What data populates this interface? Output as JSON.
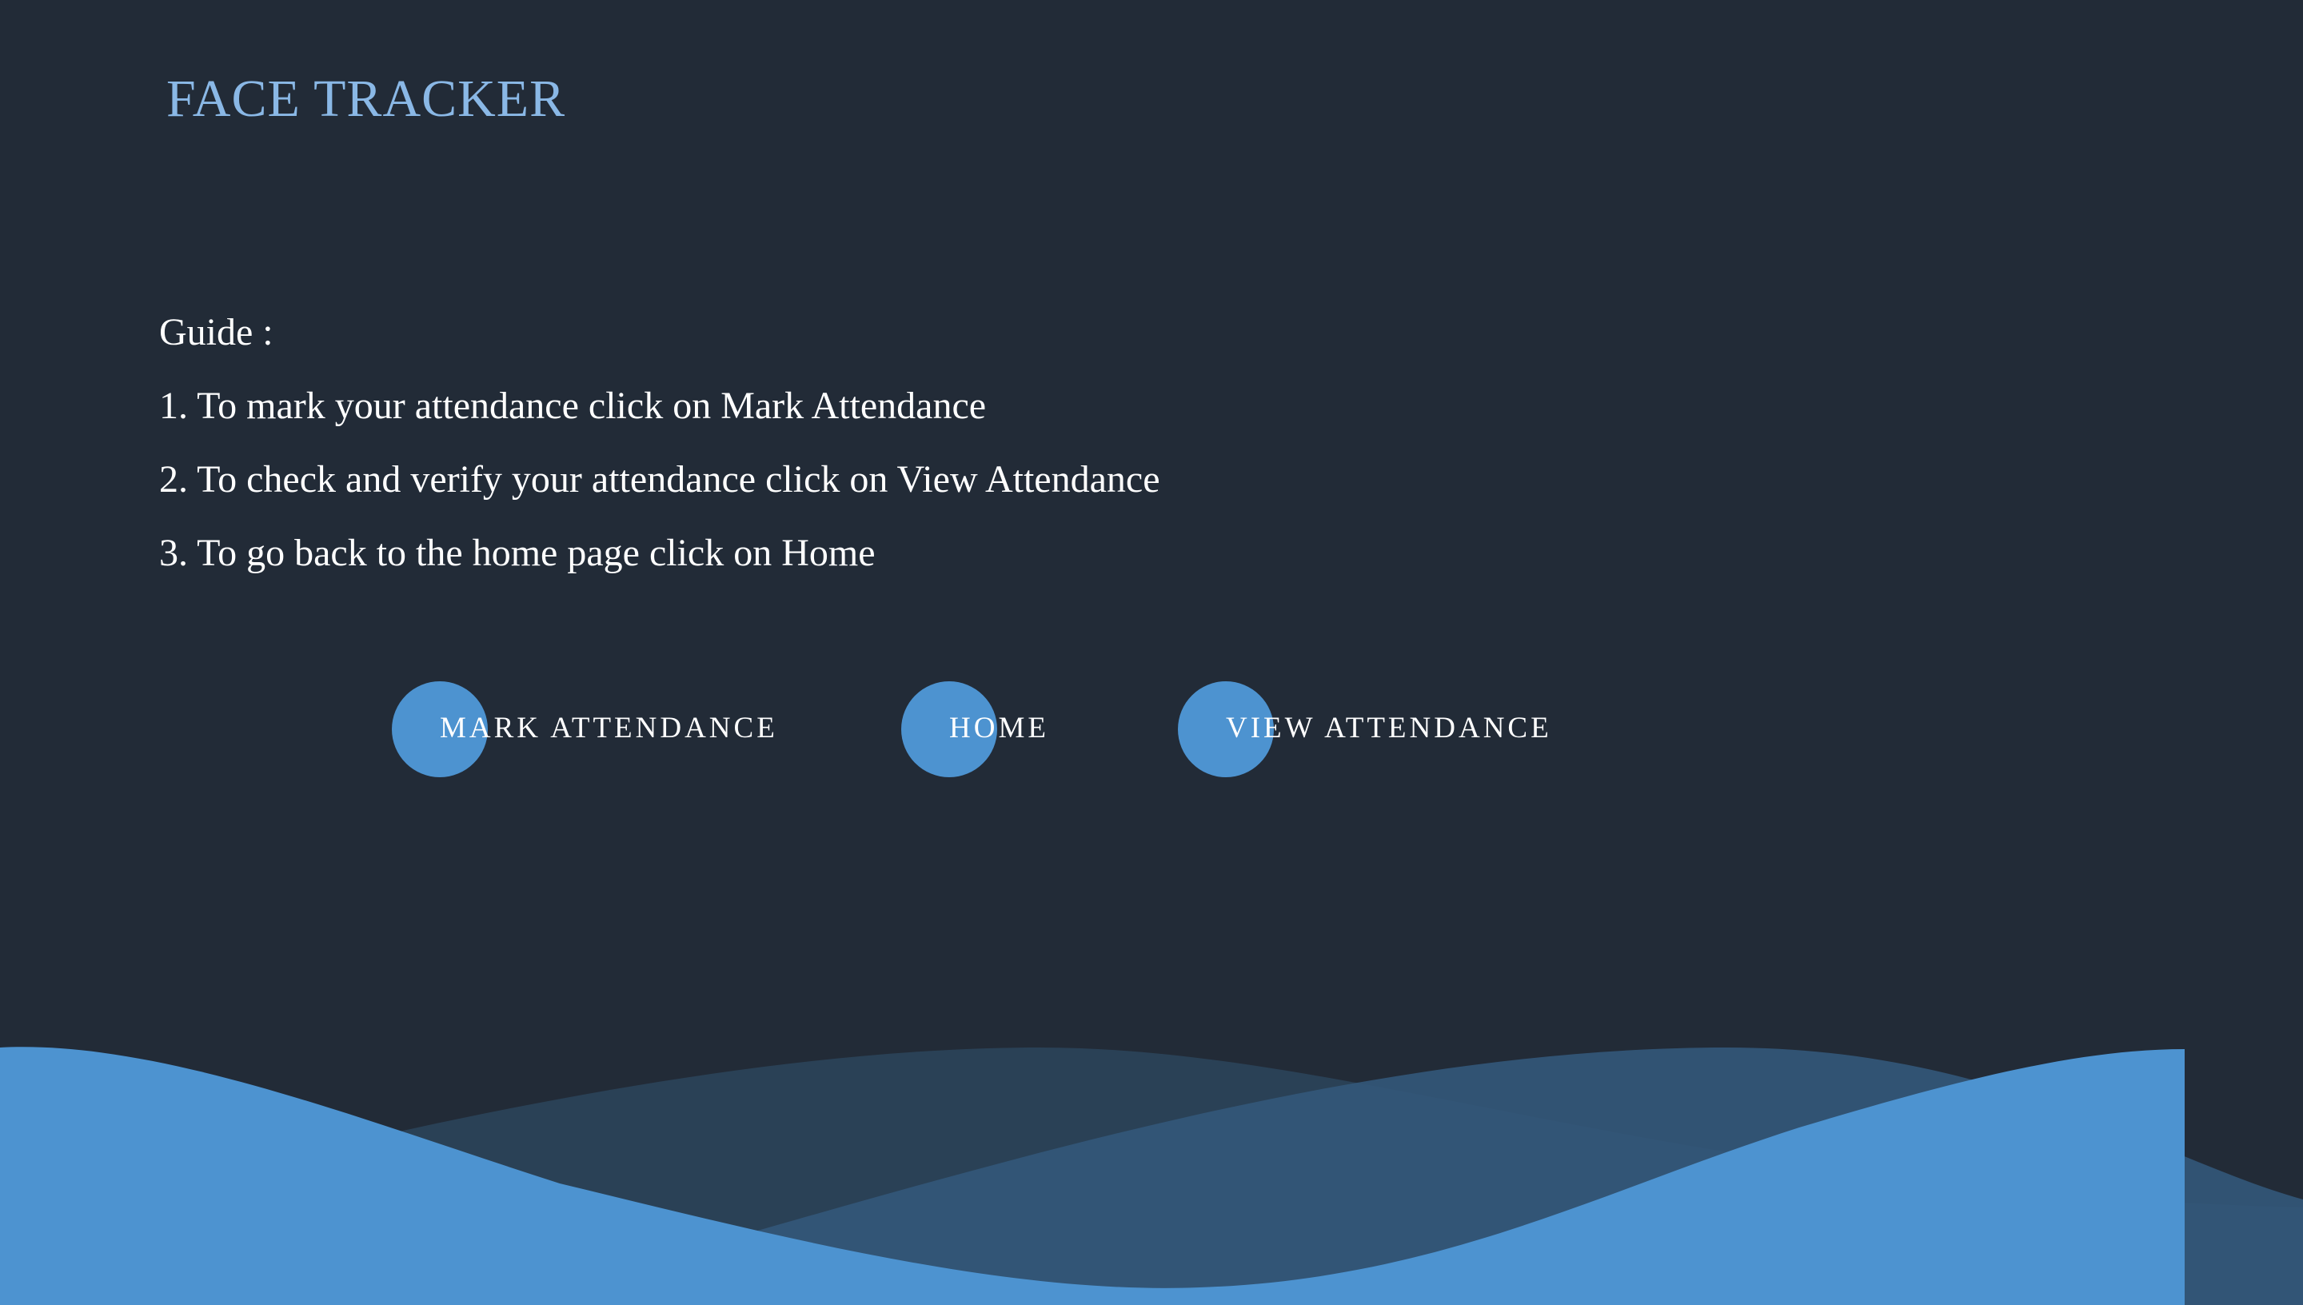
{
  "brand": {
    "title": "FACE TRACKER"
  },
  "guide": {
    "heading": "Guide :",
    "steps": [
      "1. To mark your attendance click on Mark Attendance",
      "2. To check and verify your attendance click on View Attendance",
      "3. To go back to the home page click on Home"
    ]
  },
  "nav": {
    "mark_attendance": "MARK ATTENDANCE",
    "home": "HOME",
    "view_attendance": "VIEW ATTENDANCE"
  },
  "colors": {
    "background": "#222b37",
    "accent": "#4d93d0",
    "brand": "#8ab8e6",
    "text": "#ffffff"
  }
}
